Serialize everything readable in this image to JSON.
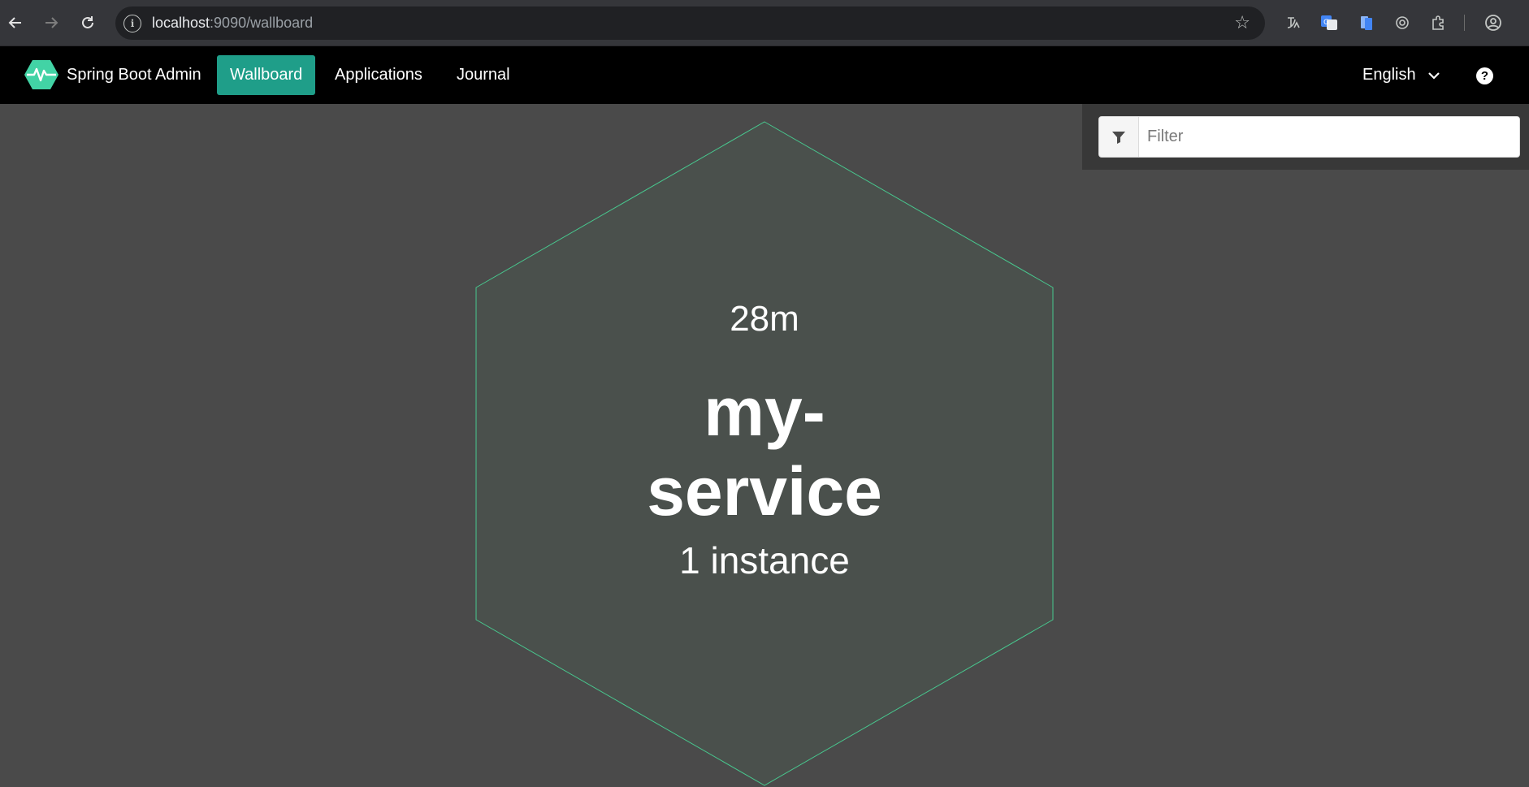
{
  "browser": {
    "url_host": "localhost",
    "url_path": ":9090/wallboard"
  },
  "navbar": {
    "brand": "Spring Boot Admin",
    "links": [
      {
        "label": "Wallboard",
        "active": true
      },
      {
        "label": "Applications",
        "active": false
      },
      {
        "label": "Journal",
        "active": false
      }
    ],
    "language": "English",
    "help_icon": "?"
  },
  "filter": {
    "placeholder": "Filter",
    "value": ""
  },
  "wallboard": {
    "applications": [
      {
        "uptime": "28m",
        "name": "my-service",
        "instances": "1 instance",
        "status_color": "#48c78e"
      }
    ]
  },
  "colors": {
    "accent": "#1f9e89",
    "hex_fill": "#4a504c",
    "hex_stroke": "#48c78e",
    "background": "#4a4a4a"
  }
}
